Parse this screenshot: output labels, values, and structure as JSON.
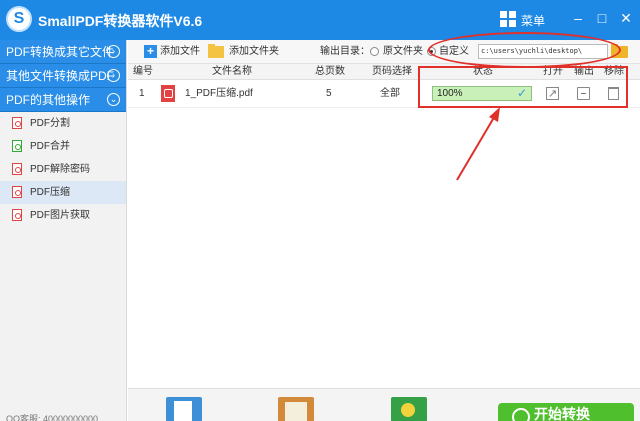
{
  "app": {
    "logo_letter": "S",
    "title": "SmallPDF转换器软件V6.6",
    "menu_label": "菜单",
    "minimize": "–",
    "maximize": "□",
    "close": "✕"
  },
  "sidebar": {
    "categories": [
      {
        "label": "PDF转换成其它文件",
        "chevron": "›"
      },
      {
        "label": "其他文件转换成PDF",
        "chevron": "›"
      },
      {
        "label": "PDF的其他操作",
        "chevron": "⌄"
      }
    ],
    "items": [
      {
        "label": "PDF分割",
        "icon": "pdf-split-icon"
      },
      {
        "label": "PDF合并",
        "icon": "pdf-merge-icon"
      },
      {
        "label": "PDF解除密码",
        "icon": "pdf-unlock-icon"
      },
      {
        "label": "PDF压缩",
        "icon": "pdf-compress-icon",
        "active": true
      },
      {
        "label": "PDF图片获取",
        "icon": "pdf-image-icon"
      }
    ],
    "footer": "QQ客服: 40000000000"
  },
  "toolbar": {
    "add_file": "添加文件",
    "add_folder": "添加文件夹",
    "output_dir_label": "输出目录：",
    "option_original": "原文件夹",
    "option_custom": "自定义",
    "selected_option": "自定义",
    "path_value": "c:\\users\\yuchli\\desktop\\"
  },
  "table": {
    "headers": {
      "index": "编号",
      "filename": "文件名称",
      "pages": "总页数",
      "page_select": "页码选择",
      "status": "状态",
      "open": "打开",
      "output": "输出",
      "remove": "移除"
    },
    "rows": [
      {
        "index": "1",
        "filename": "1_PDF压缩.pdf",
        "pages": "5",
        "page_select": "全部",
        "status": "100%",
        "progress": 1.0
      }
    ]
  },
  "bottom": {
    "start_button": "开始转换"
  },
  "colors": {
    "title_bar": "#1e88e5",
    "accent_blue": "#2a8ee8",
    "status_green": "#c8f0b8",
    "start_green": "#4fbf2e",
    "annotation_red": "#e0302a"
  }
}
